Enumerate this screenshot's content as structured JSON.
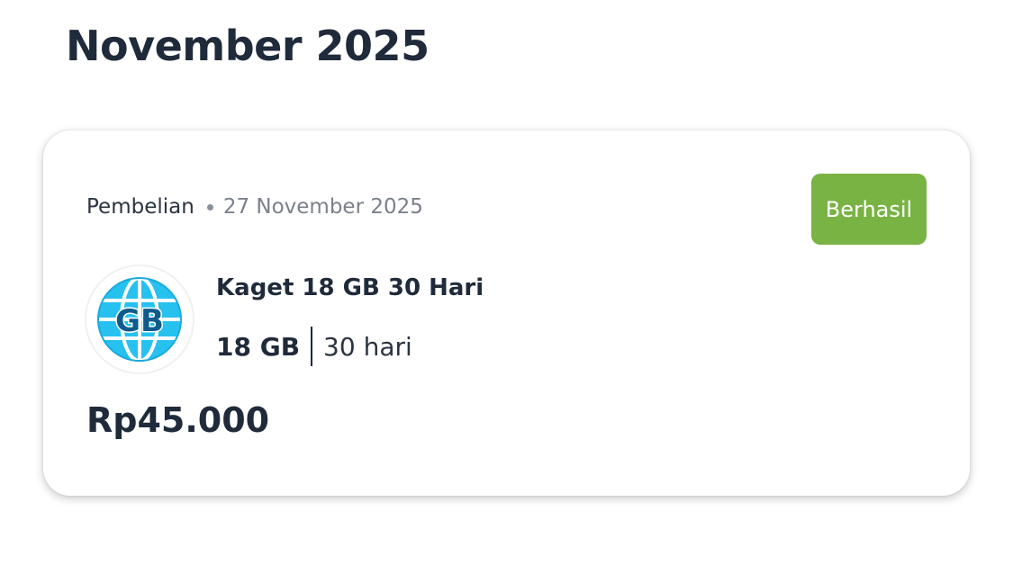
{
  "section": {
    "month_title": "November 2025"
  },
  "transaction": {
    "type": "Pembelian",
    "date": "27 November 2025",
    "status": "Berhasil",
    "status_color": "#79b344",
    "product": {
      "icon": "globe-gb-icon",
      "icon_text": "GB",
      "name": "Kaget 18 GB 30 Hari",
      "quota": "18 GB",
      "duration": "30 hari"
    },
    "price": "Rp45.000"
  }
}
